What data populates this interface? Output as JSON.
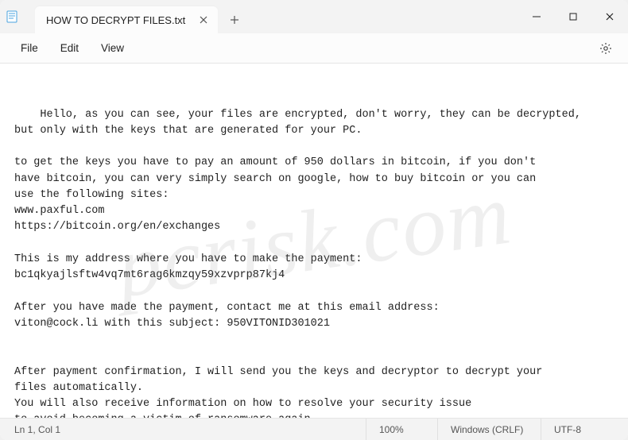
{
  "tab": {
    "title": "HOW TO DECRYPT FILES.txt"
  },
  "menu": {
    "file": "File",
    "edit": "Edit",
    "view": "View"
  },
  "document": {
    "text": "Hello, as you can see, your files are encrypted, don't worry, they can be decrypted,\nbut only with the keys that are generated for your PC.\n\nto get the keys you have to pay an amount of 950 dollars in bitcoin, if you don't\nhave bitcoin, you can very simply search on google, how to buy bitcoin or you can\nuse the following sites:\nwww.paxful.com\nhttps://bitcoin.org/en/exchanges\n\nThis is my address where you have to make the payment:\nbc1qkyajlsftw4vq7mt6rag6kmzqy59xzvprp87kj4\n\nAfter you have made the payment, contact me at this email address:\nviton@cock.li with this subject: 950VITONID301021\n\n\nAfter payment confirmation, I will send you the keys and decryptor to decrypt your\nfiles automatically.\nYou will also receive information on how to resolve your security issue\nto avoid becoming a victim of ransomware again."
  },
  "status": {
    "position": "Ln 1, Col 1",
    "zoom": "100%",
    "eol": "Windows (CRLF)",
    "encoding": "UTF-8"
  },
  "watermark": "pcrisk.com"
}
